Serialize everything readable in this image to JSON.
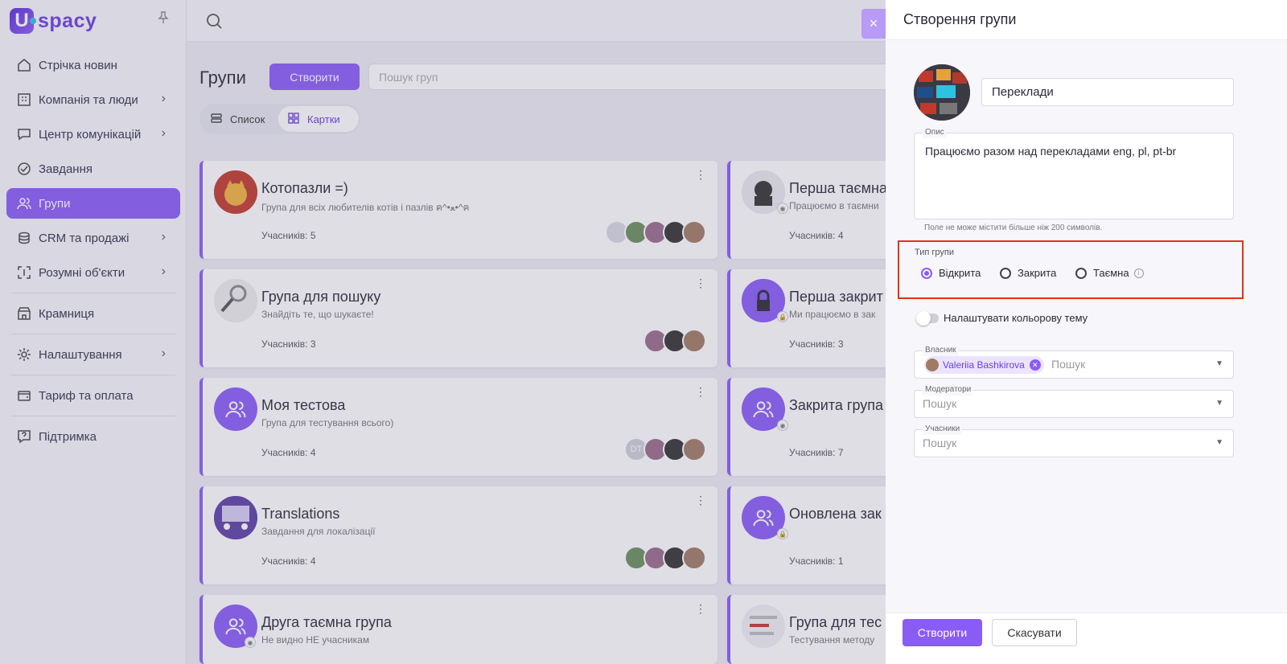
{
  "app": {
    "logo_letter": "U",
    "logo_text": "spacy"
  },
  "sidebar": {
    "items": [
      {
        "label": "Стрічка новин"
      },
      {
        "label": "Компанія та люди"
      },
      {
        "label": "Центр комунікацій"
      },
      {
        "label": "Завдання"
      },
      {
        "label": "Групи"
      },
      {
        "label": "CRM та продажі"
      },
      {
        "label": "Розумні об'єкти"
      },
      {
        "label": "Крамниця"
      },
      {
        "label": "Налаштування"
      },
      {
        "label": "Тариф та оплата"
      },
      {
        "label": "Підтримка"
      }
    ],
    "active_index": 4
  },
  "main": {
    "title": "Групи",
    "create_label": "Створити",
    "search_placeholder": "Пошук груп",
    "view_list": "Список",
    "view_cards": "Картки"
  },
  "cards": [
    {
      "title": "Котопазли =)",
      "desc": "Група для всіх любителів котів і пазлів ฅ^•ﻌ•^ฅ",
      "members": "Учасників: 5"
    },
    {
      "title": "Перша таємна",
      "desc": "Працюємо в таємни",
      "members": "Учасників: 4"
    },
    {
      "title": "Група для пошуку",
      "desc": "Знайдіть те, що шукаєте!",
      "members": "Учасників: 3"
    },
    {
      "title": "Перша закрит",
      "desc": "Ми працюємо в зак",
      "members": "Учасників: 3"
    },
    {
      "title": "Моя тестова",
      "desc": "Група для тестування всього)",
      "members": "Учасників: 4",
      "initials": "DT"
    },
    {
      "title": "Закрита група",
      "desc": "",
      "members": "Учасників: 7"
    },
    {
      "title": "Translations",
      "desc": "Завдання для локалізації",
      "members": "Учасників: 4"
    },
    {
      "title": "Оновлена зак",
      "desc": "",
      "members": "Учасників: 1"
    },
    {
      "title": "Друга таємна група",
      "desc": "Не видно НЕ учасникам",
      "members": ""
    },
    {
      "title": "Група для тес",
      "desc": "Тестування методу",
      "members": ""
    }
  ],
  "drawer": {
    "close_symbol": "×",
    "title": "Створення групи",
    "name_value": "Переклади",
    "desc_legend": "Опис",
    "desc_value": "Працюємо разом над перекладами eng, pl, pt-br",
    "desc_hint": "Поле не може містити більше ніж 200 символів.",
    "type_label": "Тип групи",
    "types": [
      "Відкрита",
      "Закрита",
      "Таємна"
    ],
    "type_selected": "Відкрита",
    "info_symbol": "i",
    "color_theme_label": "Налаштувати кольорову тему",
    "owner_legend": "Власник",
    "owner_chip": "Valeriia Bashkirova",
    "owner_placeholder": "Пошук",
    "moderators_legend": "Модератори",
    "moderators_placeholder": "Пошук",
    "members_legend": "Учасники",
    "members_placeholder": "Пошук",
    "submit_label": "Створити",
    "cancel_label": "Скасувати"
  },
  "colors": {
    "accent": "#8a5cf6",
    "highlight": "#e8301a"
  }
}
